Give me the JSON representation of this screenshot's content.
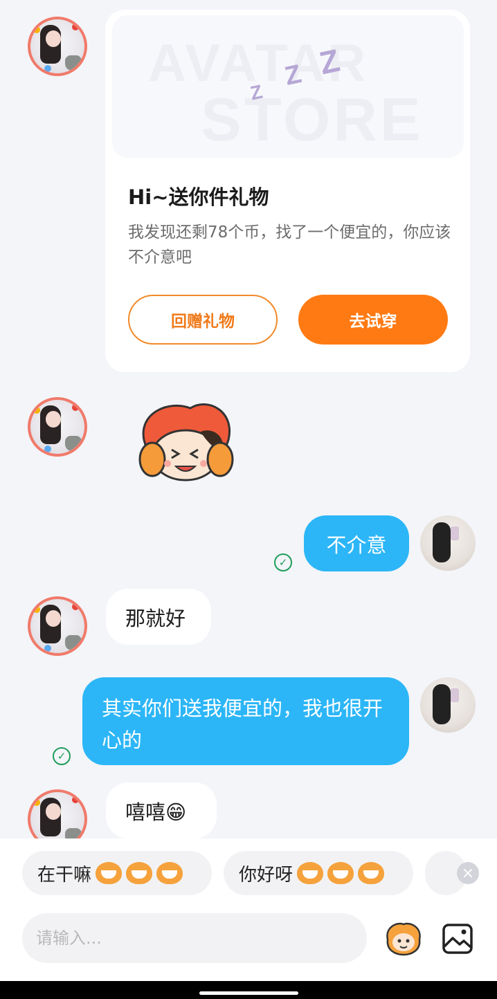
{
  "card": {
    "banner_text_line1": "AVATAR",
    "banner_text_line2": "STORE",
    "title": "Hi~送你件礼物",
    "description": "我发现还剩78个币，找了一个便宜的，你应该不介意吧",
    "return_gift_label": "回赠礼物",
    "try_on_label": "去试穿"
  },
  "messages": [
    {
      "side": "right",
      "text": "不介意",
      "status": "sent-check"
    },
    {
      "side": "left",
      "text": "那就好"
    },
    {
      "side": "right",
      "text": "其实你们送我便宜的，我也很开心的",
      "status": "sent-check"
    },
    {
      "side": "left",
      "text": "嘻嘻😁"
    }
  ],
  "quick_replies": [
    {
      "label": "在干嘛"
    },
    {
      "label": "你好呀"
    }
  ],
  "input": {
    "placeholder": "请输入..."
  },
  "icons": {
    "sticker_button": "mascot-emoji-icon",
    "image_button": "image-icon",
    "close_quick_replies": "close-icon",
    "check": "check-circle-icon"
  },
  "colors": {
    "accent_orange": "#ff7a12",
    "bubble_blue": "#2cb6f7",
    "check_green": "#1f9d5a",
    "background": "#f3f5f9"
  }
}
